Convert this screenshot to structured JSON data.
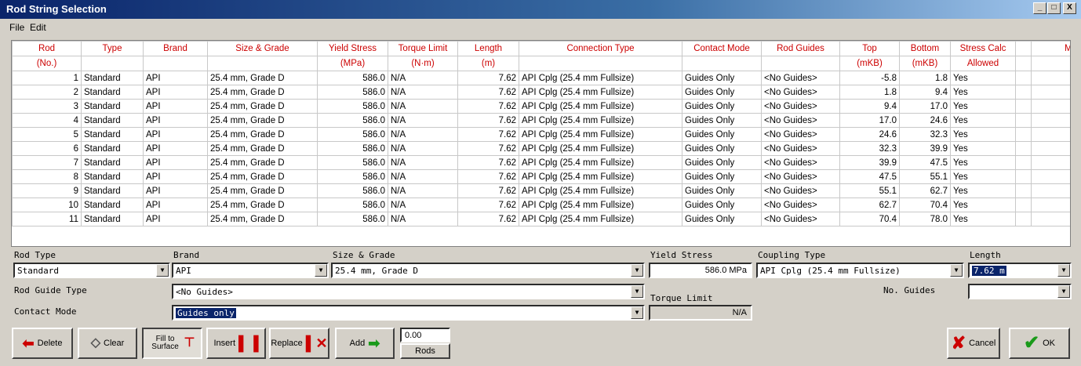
{
  "window": {
    "title": "Rod String Selection",
    "min": "_",
    "max": "□",
    "close": "X"
  },
  "menu": [
    "File",
    "Edit"
  ],
  "grid": {
    "headers": [
      "Rod",
      "Type",
      "Brand",
      "Size & Grade",
      "Yield Stress",
      "Torque Limit",
      "Length",
      "Connection Type",
      "Contact Mode",
      "Rod Guides",
      "Top",
      "Bottom",
      "Stress Calc",
      "",
      "Mir"
    ],
    "units": [
      "(No.)",
      "",
      "",
      "",
      "(MPa)",
      "(N·m)",
      "(m)",
      "",
      "",
      "",
      "(mKB)",
      "(mKB)",
      "Allowed",
      "",
      ""
    ],
    "rows": [
      [
        "1",
        "Standard",
        "API",
        "25.4 mm, Grade D",
        "586.0",
        "N/A",
        "7.62",
        "API Cplg (25.4 mm Fullsize)",
        "Guides Only",
        "<No Guides>",
        "-5.8",
        "1.8",
        "Yes"
      ],
      [
        "2",
        "Standard",
        "API",
        "25.4 mm, Grade D",
        "586.0",
        "N/A",
        "7.62",
        "API Cplg (25.4 mm Fullsize)",
        "Guides Only",
        "<No Guides>",
        "1.8",
        "9.4",
        "Yes"
      ],
      [
        "3",
        "Standard",
        "API",
        "25.4 mm, Grade D",
        "586.0",
        "N/A",
        "7.62",
        "API Cplg (25.4 mm Fullsize)",
        "Guides Only",
        "<No Guides>",
        "9.4",
        "17.0",
        "Yes"
      ],
      [
        "4",
        "Standard",
        "API",
        "25.4 mm, Grade D",
        "586.0",
        "N/A",
        "7.62",
        "API Cplg (25.4 mm Fullsize)",
        "Guides Only",
        "<No Guides>",
        "17.0",
        "24.6",
        "Yes"
      ],
      [
        "5",
        "Standard",
        "API",
        "25.4 mm, Grade D",
        "586.0",
        "N/A",
        "7.62",
        "API Cplg (25.4 mm Fullsize)",
        "Guides Only",
        "<No Guides>",
        "24.6",
        "32.3",
        "Yes"
      ],
      [
        "6",
        "Standard",
        "API",
        "25.4 mm, Grade D",
        "586.0",
        "N/A",
        "7.62",
        "API Cplg (25.4 mm Fullsize)",
        "Guides Only",
        "<No Guides>",
        "32.3",
        "39.9",
        "Yes"
      ],
      [
        "7",
        "Standard",
        "API",
        "25.4 mm, Grade D",
        "586.0",
        "N/A",
        "7.62",
        "API Cplg (25.4 mm Fullsize)",
        "Guides Only",
        "<No Guides>",
        "39.9",
        "47.5",
        "Yes"
      ],
      [
        "8",
        "Standard",
        "API",
        "25.4 mm, Grade D",
        "586.0",
        "N/A",
        "7.62",
        "API Cplg (25.4 mm Fullsize)",
        "Guides Only",
        "<No Guides>",
        "47.5",
        "55.1",
        "Yes"
      ],
      [
        "9",
        "Standard",
        "API",
        "25.4 mm, Grade D",
        "586.0",
        "N/A",
        "7.62",
        "API Cplg (25.4 mm Fullsize)",
        "Guides Only",
        "<No Guides>",
        "55.1",
        "62.7",
        "Yes"
      ],
      [
        "10",
        "Standard",
        "API",
        "25.4 mm, Grade D",
        "586.0",
        "N/A",
        "7.62",
        "API Cplg (25.4 mm Fullsize)",
        "Guides Only",
        "<No Guides>",
        "62.7",
        "70.4",
        "Yes"
      ],
      [
        "11",
        "Standard",
        "API",
        "25.4 mm, Grade D",
        "586.0",
        "N/A",
        "7.62",
        "API Cplg (25.4 mm Fullsize)",
        "Guides Only",
        "<No Guides>",
        "70.4",
        "78.0",
        "Yes"
      ]
    ]
  },
  "form": {
    "rod_type": {
      "label": "Rod Type",
      "value": "Standard"
    },
    "brand": {
      "label": "Brand",
      "value": "API"
    },
    "size_grade": {
      "label": "Size & Grade",
      "value": "25.4 mm, Grade D"
    },
    "yield_stress": {
      "label": "Yield Stress",
      "value": "586.0 MPa"
    },
    "coupling_type": {
      "label": "Coupling Type",
      "value": "API Cplg (25.4 mm Fullsize)"
    },
    "length": {
      "label": "Length",
      "value": "7.62 m"
    },
    "rod_guide_type": {
      "label": "Rod Guide Type",
      "value": "<No Guides>"
    },
    "no_guides": {
      "label": "No. Guides",
      "value": ""
    },
    "torque_limit": {
      "label": "Torque Limit",
      "value": "N/A"
    },
    "contact_mode": {
      "label": "Contact Mode",
      "value": "Guides only"
    }
  },
  "buttons": {
    "delete": "Delete",
    "clear": "Clear",
    "fill_to_surface": "Fill to Surface",
    "insert": "Insert",
    "replace": "Replace",
    "add": "Add",
    "rods_value": "0.00",
    "rods": "Rods",
    "cancel": "Cancel",
    "ok": "OK"
  },
  "colors": {
    "header_text": "#cc0000",
    "title_bar": "#0a246a",
    "selection": "#0a246a"
  },
  "icons": [
    "red-left-arrow-icon",
    "eraser-icon",
    "fill-surface-icon",
    "insert-rod-icon",
    "replace-rod-icon",
    "green-right-arrow-icon",
    "red-x-icon",
    "green-check-icon"
  ]
}
